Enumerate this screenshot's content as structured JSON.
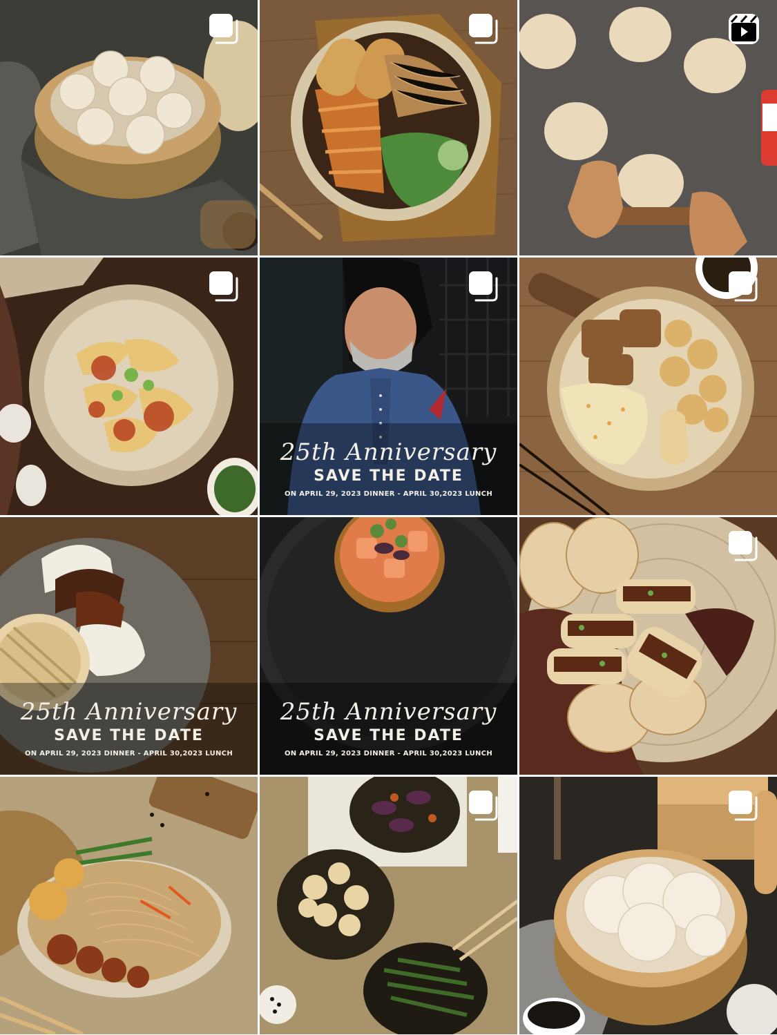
{
  "grid": {
    "tiles": [
      {
        "subject": "xiaolongbao-steamer",
        "badge": "carousel-icon"
      },
      {
        "subject": "noodle-bowl",
        "badge": "carousel-icon"
      },
      {
        "subject": "dough-rolling",
        "badge": "reels-icon"
      },
      {
        "subject": "wonton-chili-oil",
        "badge": "carousel-icon"
      },
      {
        "subject": "chef-portrait",
        "badge": "carousel-icon",
        "overlay": {
          "title": "25th Anniversary",
          "heading": "SAVE THE DATE",
          "details": "ON APRIL 29, 2023 DINNER - APRIL 30,2023 LUNCH"
        }
      },
      {
        "subject": "rice-bowl-chicken",
        "badge": "carousel-icon"
      },
      {
        "subject": "gua-bao",
        "badge": "none",
        "overlay": {
          "title": "25th Anniversary",
          "heading": "SAVE THE DATE",
          "details": "ON APRIL 29, 2023 DINNER - APRIL 30,2023 LUNCH"
        }
      },
      {
        "subject": "salmon-tartare",
        "badge": "none",
        "overlay": {
          "title": "25th Anniversary",
          "heading": "SAVE THE DATE",
          "details": "ON APRIL 29, 2023 DINNER - APRIL 30,2023 LUNCH"
        }
      },
      {
        "subject": "roujiamo-buns",
        "badge": "carousel-icon"
      },
      {
        "subject": "chow-mein",
        "badge": "none"
      },
      {
        "subject": "three-dishes",
        "badge": "carousel-icon"
      },
      {
        "subject": "xiaolongbao-close",
        "badge": "carousel-icon"
      }
    ]
  },
  "colors": {
    "badge": "#ffffff",
    "overlay_text": "#f4efe7"
  }
}
